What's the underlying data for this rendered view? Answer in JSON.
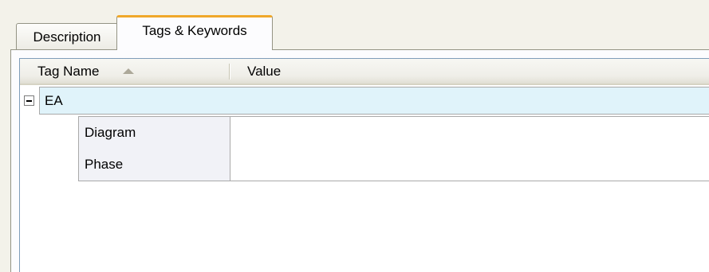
{
  "tabs": [
    {
      "label": "Description",
      "active": false
    },
    {
      "label": "Tags & Keywords",
      "active": true
    }
  ],
  "grid": {
    "columns": [
      {
        "label": "Tag Name",
        "sort": "ascending"
      },
      {
        "label": "Value"
      }
    ],
    "groups": [
      {
        "name": "EA",
        "expanded": true,
        "rows": [
          {
            "name": "Diagram",
            "value": ""
          },
          {
            "name": "Phase",
            "value": ""
          }
        ]
      }
    ]
  },
  "colors": {
    "active_tab_accent": "#f0a82a",
    "group_row_bg": "#e0f3fa",
    "panel_bg": "#f3f2ea"
  },
  "icons": {
    "sort": "sort-ascending-icon",
    "expander": "collapse-minus-icon"
  }
}
